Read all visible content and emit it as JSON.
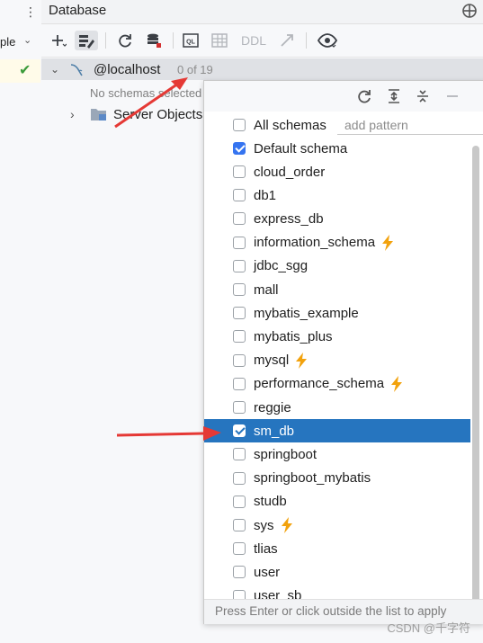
{
  "panel": {
    "title": "Database"
  },
  "left": {
    "combo_text": "ple",
    "check": "✔"
  },
  "toolbar": {
    "items": [
      {
        "icon": "add-icon",
        "glyph": "+"
      },
      {
        "icon": "datasource-properties-icon",
        "glyph": "⚙"
      },
      {
        "icon": "refresh-icon",
        "glyph": "⟳"
      },
      {
        "icon": "db-stop-icon",
        "glyph": "≡"
      },
      {
        "icon": "query-console-icon",
        "glyph": "QL"
      },
      {
        "icon": "table-editor-icon",
        "glyph": "▦"
      },
      {
        "icon": "ddl-label",
        "glyph": "DDL"
      },
      {
        "icon": "jump-icon",
        "glyph": "↗"
      },
      {
        "icon": "eye-icon",
        "glyph": "◉"
      }
    ]
  },
  "tree": {
    "host": "@localhost",
    "host_count": "0 of 19",
    "no_schemas": "No schemas selected",
    "server_objects": "Server Objects"
  },
  "popup": {
    "all_schemas": "All schemas",
    "add_pattern": "add pattern",
    "default_schema": "Default schema",
    "schemas": [
      {
        "name": "cloud_order",
        "checked": false,
        "bolt": false
      },
      {
        "name": "db1",
        "checked": false,
        "bolt": false
      },
      {
        "name": "express_db",
        "checked": false,
        "bolt": false
      },
      {
        "name": "information_schema",
        "checked": false,
        "bolt": true
      },
      {
        "name": "jdbc_sgg",
        "checked": false,
        "bolt": false
      },
      {
        "name": "mall",
        "checked": false,
        "bolt": false
      },
      {
        "name": "mybatis_example",
        "checked": false,
        "bolt": false
      },
      {
        "name": "mybatis_plus",
        "checked": false,
        "bolt": false
      },
      {
        "name": "mysql",
        "checked": false,
        "bolt": true
      },
      {
        "name": "performance_schema",
        "checked": false,
        "bolt": true
      },
      {
        "name": "reggie",
        "checked": false,
        "bolt": false
      },
      {
        "name": "sm_db",
        "checked": true,
        "bolt": false,
        "selected": true
      },
      {
        "name": "springboot",
        "checked": false,
        "bolt": false
      },
      {
        "name": "springboot_mybatis",
        "checked": false,
        "bolt": false
      },
      {
        "name": "studb",
        "checked": false,
        "bolt": false
      },
      {
        "name": "sys",
        "checked": false,
        "bolt": true
      },
      {
        "name": "tlias",
        "checked": false,
        "bolt": false
      },
      {
        "name": "user",
        "checked": false,
        "bolt": false
      },
      {
        "name": "user_sb",
        "checked": false,
        "bolt": false
      }
    ],
    "footer": "Press Enter or click outside the list to apply"
  },
  "watermark": "CSDN @千字符",
  "colors": {
    "accent": "#3574f0",
    "selection": "#2675bf",
    "bolt": "#f2a20d",
    "arrow": "#e53935"
  }
}
